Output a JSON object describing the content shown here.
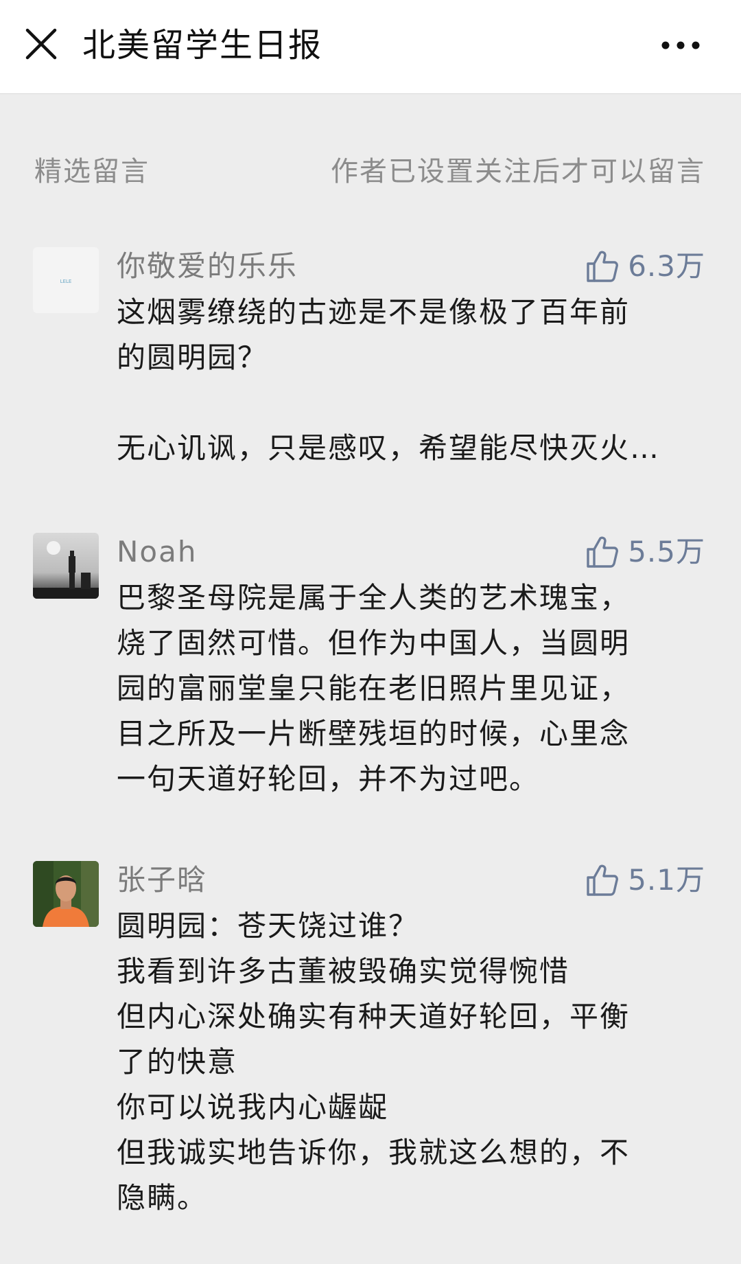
{
  "topbar": {
    "title": "北美留学生日报",
    "close_icon": "close-icon",
    "more_icon": "more-icon"
  },
  "section": {
    "left_label": "精选留言",
    "right_label": "作者已设置关注后才可以留言"
  },
  "comments": [
    {
      "name": "你敬爱的乐乐",
      "avatar_text": "LELE",
      "likes": "6.3万",
      "lines": [
        "这烟雾缭绕的古迹是不是像极了百年前",
        "的圆明园？",
        "",
        "无心讥讽，只是感叹，希望能尽快灭火…"
      ]
    },
    {
      "name": "Noah",
      "likes": "5.5万",
      "lines": [
        "巴黎圣母院是属于全人类的艺术瑰宝，",
        "烧了固然可惜。但作为中国人，当圆明",
        "园的富丽堂皇只能在老旧照片里见证，",
        "目之所及一片断壁残垣的时候，心里念",
        "一句天道好轮回，并不为过吧。"
      ]
    },
    {
      "name": "张子晗",
      "likes": "5.1万",
      "lines": [
        "圆明园：苍天饶过谁？",
        "我看到许多古董被毁确实觉得惋惜",
        "但内心深处确实有种天道好轮回，平衡",
        "了的快意",
        "你可以说我内心龌龊",
        "但我诚实地告诉你，我就这么想的，不",
        "隐瞒。"
      ]
    }
  ],
  "colors": {
    "background": "#ededed",
    "like_accent": "#6c7c98",
    "secondary_text": "#8c8c8c"
  }
}
